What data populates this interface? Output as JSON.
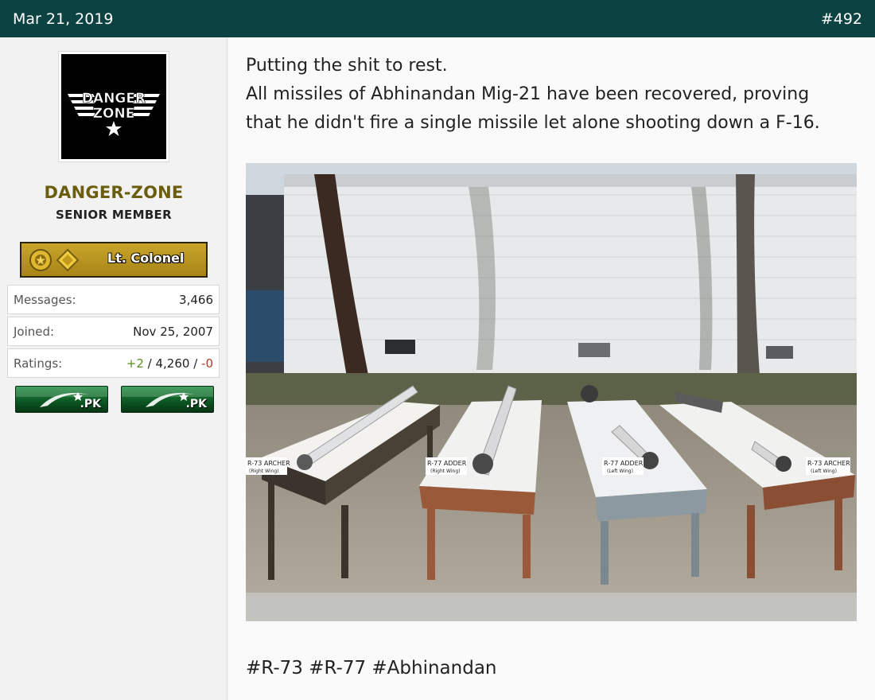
{
  "post": {
    "date": "Mar 21, 2019",
    "number": "#492",
    "lines": [
      "Putting the shit to rest.",
      "All missiles of Abhinandan Mig-21 have been recovered, proving",
      "that he didn't fire a single missile let alone shooting down a F-16."
    ],
    "hashtags": "#R-73 #R-77 #Abhinandan"
  },
  "user": {
    "avatar_text_line1": "DANGER",
    "avatar_text_line2": "ZONE",
    "name": "DANGER-ZONE",
    "title": "SENIOR MEMBER",
    "rank": "Lt. Colonel",
    "rank_color": "#b8951f",
    "messages_label": "Messages:",
    "messages": "3,466",
    "joined_label": "Joined:",
    "joined": "Nov 25, 2007",
    "ratings_label": "Ratings:",
    "ratings_pos": "+2",
    "ratings_mid": " / 4,260 / ",
    "ratings_neg": "-0",
    "flag_label_1": ".PK",
    "flag_label_2": ".PK"
  },
  "photo": {
    "labels": [
      "R-73 ARCHER",
      "R-77 ADDER",
      "R-77 ADDER",
      "R-73 ARCHER"
    ],
    "sublabels": [
      "(Right Wing)",
      "(Right Wing)",
      "(Left Wing)",
      "(Left Wing)"
    ]
  },
  "colors": {
    "header": "#0d4242",
    "username": "#6b5d0d"
  }
}
